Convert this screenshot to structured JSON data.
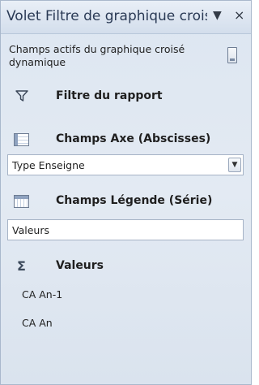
{
  "pane": {
    "title": "Volet Filtre de graphique croisé dynamique",
    "dropdown_glyph": "▼",
    "close_glyph": "×"
  },
  "active_fields_label": "Champs actifs du graphique croisé dynamique",
  "report_filter": {
    "title": "Filtre du rapport",
    "icon": "filter-icon"
  },
  "axis_fields": {
    "title": "Champs Axe (Abscisses)",
    "icon": "axis-fields-icon",
    "field_value": "Type Enseigne"
  },
  "legend_fields": {
    "title": "Champs Légende (Série)",
    "icon": "legend-fields-icon",
    "field_value": "Valeurs"
  },
  "values": {
    "title": "Valeurs",
    "icon": "sigma-icon",
    "items": [
      "CA An-1",
      "CA An"
    ]
  }
}
